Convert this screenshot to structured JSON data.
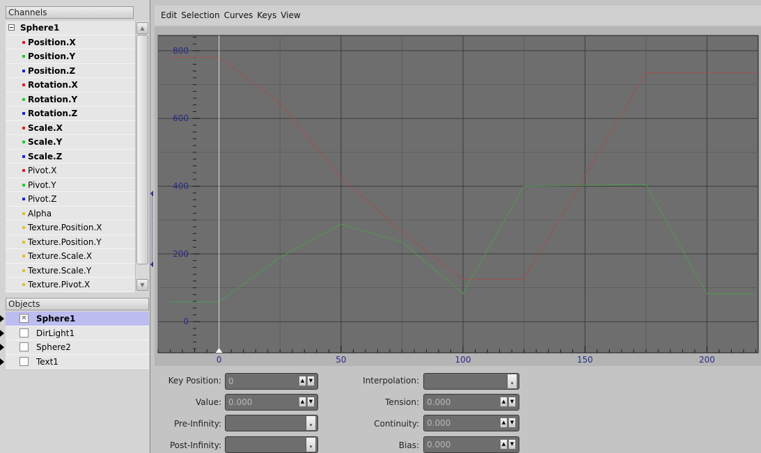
{
  "channels": {
    "header": "Channels",
    "root": "Sphere1",
    "items": [
      {
        "label": "Position.X",
        "color": "#e02020",
        "bold": true
      },
      {
        "label": "Position.Y",
        "color": "#20d020",
        "bold": true
      },
      {
        "label": "Position.Z",
        "color": "#2020e0",
        "bold": true
      },
      {
        "label": "Rotation.X",
        "color": "#e02020",
        "bold": true
      },
      {
        "label": "Rotation.Y",
        "color": "#20d020",
        "bold": true
      },
      {
        "label": "Rotation.Z",
        "color": "#2020e0",
        "bold": true
      },
      {
        "label": "Scale.X",
        "color": "#e02020",
        "bold": true
      },
      {
        "label": "Scale.Y",
        "color": "#20d020",
        "bold": true
      },
      {
        "label": "Scale.Z",
        "color": "#2020e0",
        "bold": true
      },
      {
        "label": "Pivot.X",
        "color": "#e02020",
        "bold": false
      },
      {
        "label": "Pivot.Y",
        "color": "#20d020",
        "bold": false
      },
      {
        "label": "Pivot.Z",
        "color": "#2020e0",
        "bold": false
      },
      {
        "label": "Alpha",
        "color": "#e0c020",
        "bold": false
      },
      {
        "label": "Texture.Position.X",
        "color": "#e0c020",
        "bold": false
      },
      {
        "label": "Texture.Position.Y",
        "color": "#e0c020",
        "bold": false
      },
      {
        "label": "Texture.Scale.X",
        "color": "#e0c020",
        "bold": false
      },
      {
        "label": "Texture.Scale.Y",
        "color": "#e0c020",
        "bold": false
      },
      {
        "label": "Texture.Pivot.X",
        "color": "#e0c020",
        "bold": false
      }
    ]
  },
  "objects": {
    "header": "Objects",
    "items": [
      {
        "label": "Sphere1",
        "selected": true,
        "checked": true
      },
      {
        "label": "DirLight1",
        "selected": false,
        "checked": false
      },
      {
        "label": "Sphere2",
        "selected": false,
        "checked": false
      },
      {
        "label": "Text1",
        "selected": false,
        "checked": false
      }
    ]
  },
  "menu": [
    "Edit",
    "Selection",
    "Curves",
    "Keys",
    "View"
  ],
  "graph": {
    "background": "#6e6e6e",
    "x_ticks": [
      "0",
      "50",
      "100",
      "150",
      "200"
    ],
    "y_ticks": [
      "800",
      "600",
      "400",
      "200",
      "0"
    ],
    "current_frame": 0,
    "curves": [
      {
        "color": "#a0504c",
        "points": [
          [
            -20,
            780
          ],
          [
            0,
            780
          ],
          [
            25,
            645
          ],
          [
            50,
            425
          ],
          [
            75,
            265
          ],
          [
            100,
            125
          ],
          [
            125,
            125
          ],
          [
            175,
            735
          ],
          [
            220,
            735
          ]
        ]
      },
      {
        "color": "#4f9a4f",
        "points": [
          [
            -20,
            58
          ],
          [
            0,
            58
          ],
          [
            25,
            190
          ],
          [
            50,
            288
          ],
          [
            75,
            235
          ],
          [
            100,
            83
          ],
          [
            125,
            400
          ],
          [
            175,
            405
          ],
          [
            200,
            82
          ],
          [
            220,
            82
          ]
        ]
      }
    ]
  },
  "properties": {
    "key_position": {
      "label": "Key Position:",
      "value": "0"
    },
    "value": {
      "label": "Value:",
      "value": "0.000"
    },
    "pre_infinity": {
      "label": "Pre-Infinity:",
      "value": ""
    },
    "post_infinity": {
      "label": "Post-Infinity:",
      "value": ""
    },
    "interpolation": {
      "label": "Interpolation:",
      "value": ""
    },
    "tension": {
      "label": "Tension:",
      "value": "0.000"
    },
    "continuity": {
      "label": "Continuity:",
      "value": "0.000"
    },
    "bias": {
      "label": "Bias:",
      "value": "0.000"
    }
  }
}
